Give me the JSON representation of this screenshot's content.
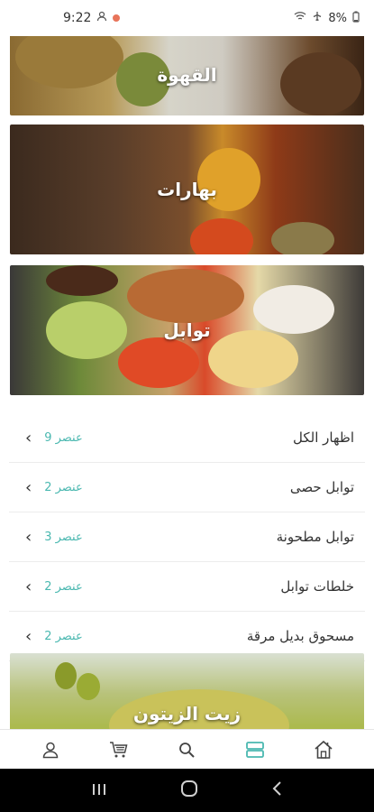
{
  "status": {
    "time": "9:22",
    "battery": "8%"
  },
  "banners": [
    {
      "title": "القهوة"
    },
    {
      "title": "بهارات"
    },
    {
      "title": "توابل"
    },
    {
      "title": "زيت الزيتون"
    }
  ],
  "list": [
    {
      "label": "اظهار الكل",
      "count": "9 عنصر"
    },
    {
      "label": "توابل حصى",
      "count": "2 عنصر"
    },
    {
      "label": "توابل مطحونة",
      "count": "3 عنصر"
    },
    {
      "label": "خلطات توابل",
      "count": "2 عنصر"
    },
    {
      "label": "مسحوق بديل مرقة",
      "count": "2 عنصر"
    }
  ],
  "nav": {
    "items": [
      "profile-icon",
      "cart-icon",
      "search-icon",
      "categories-icon",
      "home-icon"
    ],
    "active": "categories-icon",
    "accent": "#4ab8b0"
  }
}
